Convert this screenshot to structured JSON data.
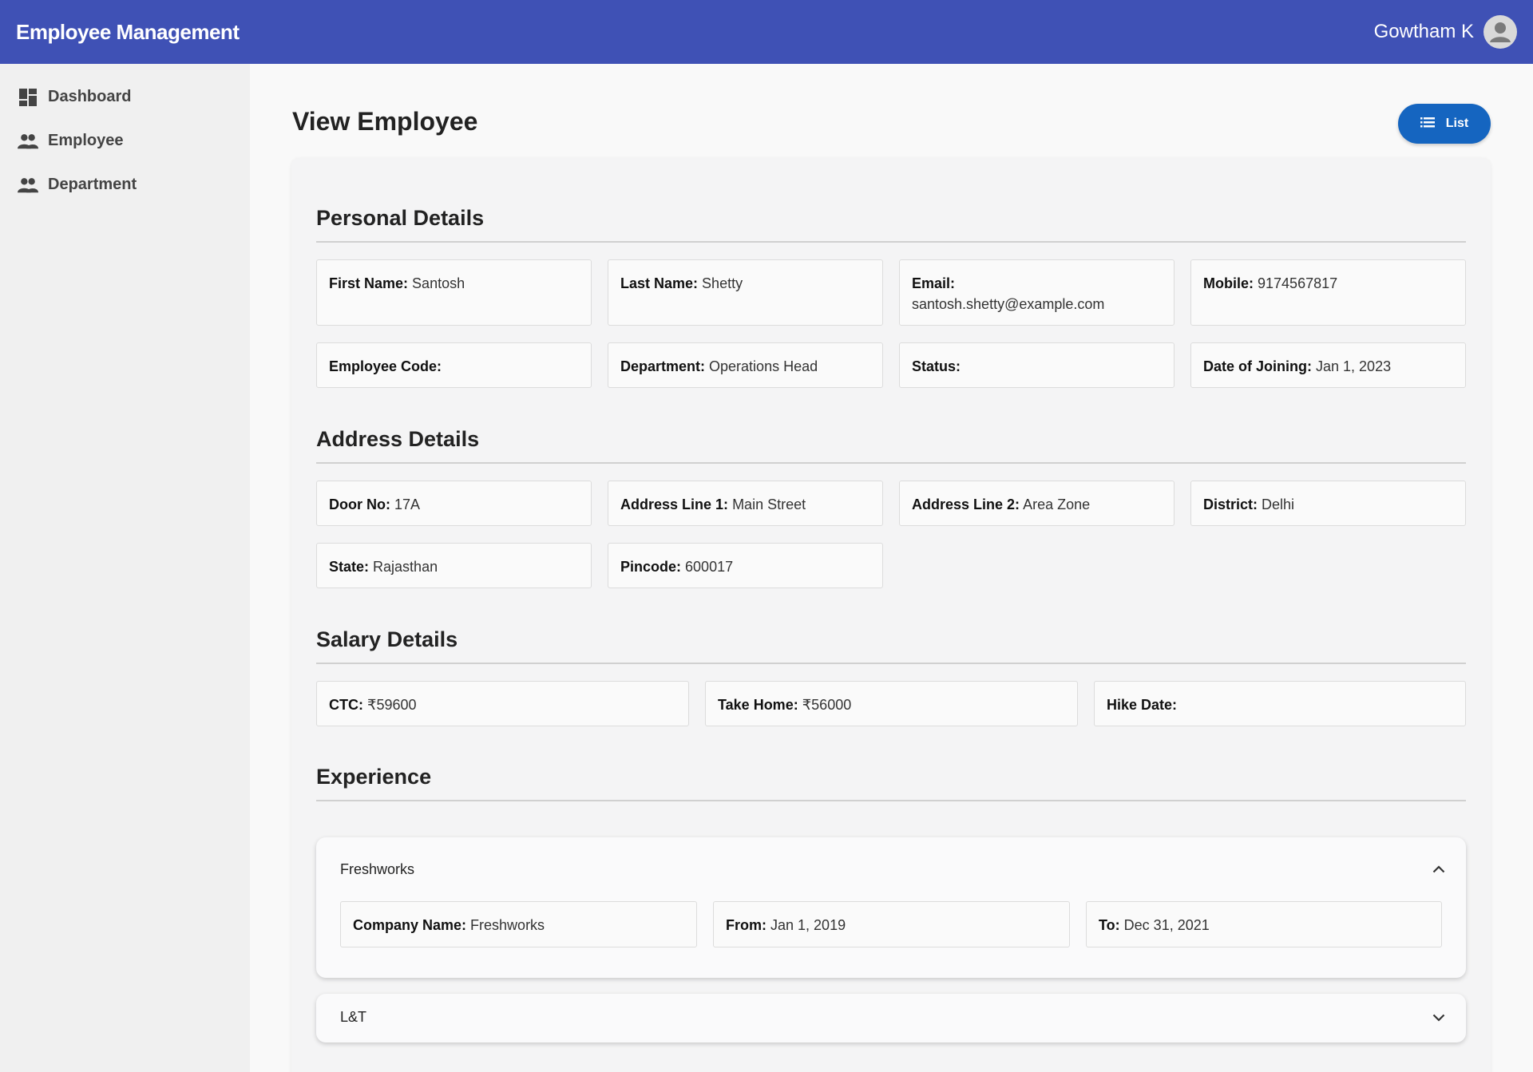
{
  "app": {
    "title": "Employee Management",
    "user_name": "Gowtham K"
  },
  "sidebar": {
    "items": [
      {
        "label": "Dashboard",
        "icon": "dashboard-icon"
      },
      {
        "label": "Employee",
        "icon": "people-icon"
      },
      {
        "label": "Department",
        "icon": "people-icon"
      }
    ]
  },
  "page": {
    "title": "View Employee",
    "list_button": "List"
  },
  "personal": {
    "title": "Personal Details",
    "first_name": {
      "label": "First Name:",
      "value": "Santosh"
    },
    "last_name": {
      "label": "Last Name:",
      "value": "Shetty"
    },
    "email": {
      "label": "Email:",
      "value": "santosh.shetty@example.com"
    },
    "mobile": {
      "label": "Mobile:",
      "value": "9174567817"
    },
    "employee_code": {
      "label": "Employee Code:",
      "value": ""
    },
    "department": {
      "label": "Department:",
      "value": "Operations Head"
    },
    "status": {
      "label": "Status:",
      "value": ""
    },
    "date_of_joining": {
      "label": "Date of Joining:",
      "value": "Jan 1, 2023"
    }
  },
  "address": {
    "title": "Address Details",
    "door_no": {
      "label": "Door No:",
      "value": "17A"
    },
    "line1": {
      "label": "Address Line 1:",
      "value": "Main Street"
    },
    "line2": {
      "label": "Address Line 2:",
      "value": "Area Zone"
    },
    "district": {
      "label": "District:",
      "value": "Delhi"
    },
    "state": {
      "label": "State:",
      "value": "Rajasthan"
    },
    "pincode": {
      "label": "Pincode:",
      "value": "600017"
    }
  },
  "salary": {
    "title": "Salary Details",
    "ctc": {
      "label": "CTC:",
      "value": "₹59600"
    },
    "take_home": {
      "label": "Take Home:",
      "value": "₹56000"
    },
    "hike_date": {
      "label": "Hike Date:",
      "value": ""
    }
  },
  "experience": {
    "title": "Experience",
    "items": [
      {
        "header": "Freshworks",
        "expanded": true,
        "company": {
          "label": "Company Name:",
          "value": "Freshworks"
        },
        "from": {
          "label": "From:",
          "value": "Jan 1, 2019"
        },
        "to": {
          "label": "To:",
          "value": "Dec 31, 2021"
        }
      },
      {
        "header": "L&T",
        "expanded": false
      }
    ]
  },
  "colors": {
    "topbar": "#3f51b5",
    "button": "#1565c0"
  }
}
